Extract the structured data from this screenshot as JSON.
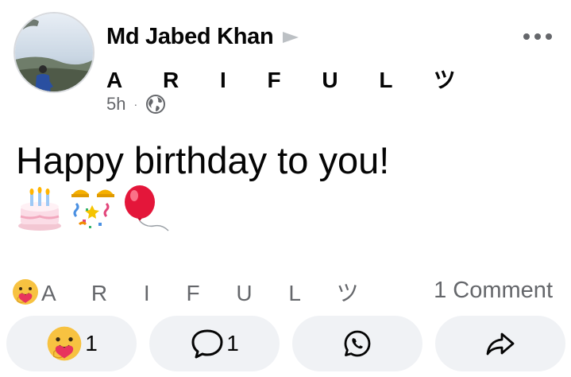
{
  "post": {
    "author_name": "Md Jabed Khan",
    "group_name": "A R I F U L ツ",
    "time": "5h",
    "separator": "·",
    "text": "Happy birthday to you!"
  },
  "icons": {
    "more": "more-options-icon",
    "privacy": "globe-icon",
    "arrow": "triangle-arrow-icon",
    "emojis": [
      "birthday-cake-emoji",
      "party-popper-emoji",
      "balloon-emoji"
    ]
  },
  "reactions": {
    "reactor_name": "A R I F U L ツ",
    "comment_count_label": "1 Comment"
  },
  "actions": {
    "react_count": "1",
    "comment_count": "1"
  },
  "colors": {
    "text_primary": "#050505",
    "text_secondary": "#65676b",
    "button_bg": "#f0f2f5"
  }
}
